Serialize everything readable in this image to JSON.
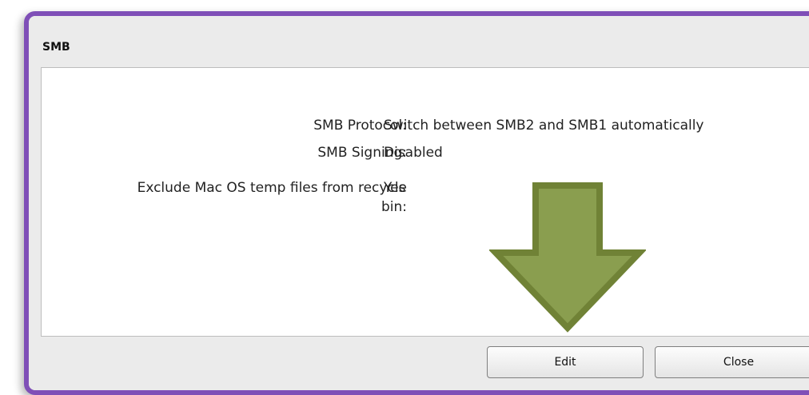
{
  "dialog": {
    "title": "SMB"
  },
  "fields": [
    {
      "label": "SMB Protocol:",
      "value": "Switch between SMB2 and SMB1 automatically"
    },
    {
      "label": "SMB Signing:",
      "value": "Disabled"
    },
    {
      "label": "Exclude Mac OS temp files from recycle bin:",
      "value": "Yes"
    }
  ],
  "buttons": {
    "edit_label": "Edit",
    "close_label": "Close"
  },
  "annotation": {
    "arrow_color": "#8a9e4f",
    "arrow_outline": "#708236",
    "frame_color": "#7f4fb7"
  }
}
